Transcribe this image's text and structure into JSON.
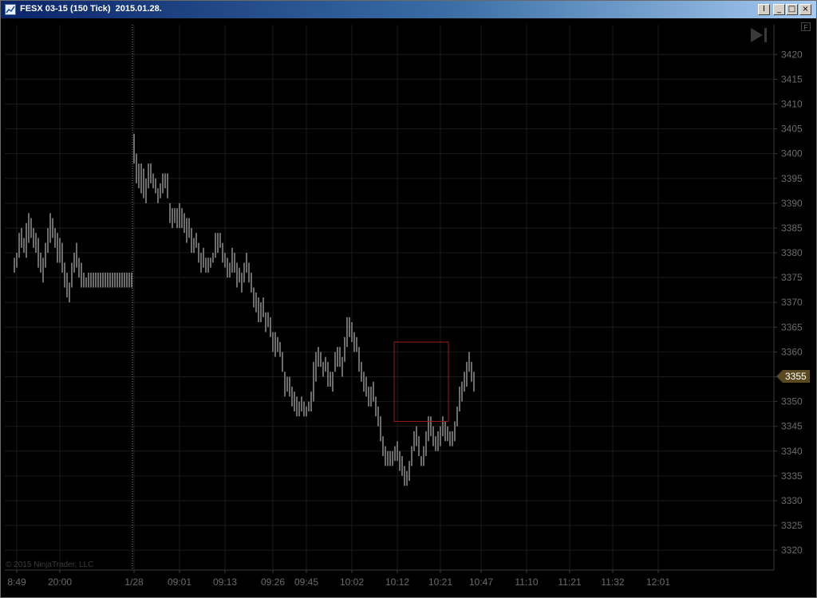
{
  "window": {
    "title": "FESX 03-15 (150 Tick)  2015.01.28.",
    "minimize_label": "_",
    "maximize_label": "□",
    "close_label": "×",
    "pin_label": "I"
  },
  "copyright": "© 2015 NinjaTrader, LLC",
  "f_label": "F",
  "last_price": "3355",
  "colors": {
    "background": "#000000",
    "bars": "#9a9a9a",
    "grid": "#1a1a1a",
    "axis_text": "#6b6b6b",
    "price_tag": "#5a4a22",
    "rectangle": "#9b1c1c",
    "session_line": "#8a8a8a"
  },
  "icons": {
    "app": "chart-icon",
    "play": "go-to-end-icon"
  },
  "chart_data": {
    "type": "bar",
    "title": "FESX 03-15 (150 Tick)",
    "subtitle": "2015.01.28.",
    "ylim": [
      3316,
      3426
    ],
    "yticks": [
      3320,
      3325,
      3330,
      3335,
      3340,
      3345,
      3350,
      3355,
      3360,
      3365,
      3370,
      3375,
      3380,
      3385,
      3390,
      3395,
      3400,
      3405,
      3410,
      3415,
      3420
    ],
    "xtick_labels": [
      "8:49",
      "20:00",
      "1/28",
      "09:01",
      "09:13",
      "09:26",
      "09:45",
      "10:02",
      "10:12",
      "10:21",
      "10:47",
      "11:10",
      "11:21",
      "11:32",
      "12:01"
    ],
    "xtick_bar_index": [
      1,
      19,
      50,
      69,
      88,
      108,
      122,
      141,
      160,
      178,
      195,
      214,
      232,
      250,
      269
    ],
    "session_break_index": 50,
    "grid": true,
    "last_price": 3355,
    "rectangle": {
      "start_index": 159,
      "end_index": 181,
      "high": 3362,
      "low": 3346
    },
    "bars": [
      [
        3379,
        3376
      ],
      [
        3380,
        3377
      ],
      [
        3384,
        3379
      ],
      [
        3385,
        3381
      ],
      [
        3383,
        3380
      ],
      [
        3386,
        3379
      ],
      [
        3388,
        3382
      ],
      [
        3387,
        3383
      ],
      [
        3385,
        3381
      ],
      [
        3384,
        3380
      ],
      [
        3383,
        3377
      ],
      [
        3380,
        3376
      ],
      [
        3379,
        3374
      ],
      [
        3382,
        3377
      ],
      [
        3385,
        3380
      ],
      [
        3388,
        3382
      ],
      [
        3387,
        3383
      ],
      [
        3385,
        3381
      ],
      [
        3384,
        3378
      ],
      [
        3383,
        3378
      ],
      [
        3382,
        3376
      ],
      [
        3378,
        3373
      ],
      [
        3376,
        3371
      ],
      [
        3374,
        3370
      ],
      [
        3378,
        3373
      ],
      [
        3380,
        3376
      ],
      [
        3382,
        3377
      ],
      [
        3379,
        3375
      ],
      [
        3378,
        3373
      ],
      [
        3376,
        3373
      ],
      [
        3375,
        3373
      ],
      [
        3376,
        3373
      ],
      [
        3376,
        3373
      ],
      [
        3376,
        3373
      ],
      [
        3376,
        3373
      ],
      [
        3376,
        3373
      ],
      [
        3376,
        3373
      ],
      [
        3376,
        3373
      ],
      [
        3376,
        3373
      ],
      [
        3376,
        3373
      ],
      [
        3376,
        3373
      ],
      [
        3376,
        3373
      ],
      [
        3376,
        3373
      ],
      [
        3376,
        3373
      ],
      [
        3376,
        3373
      ],
      [
        3376,
        3373
      ],
      [
        3376,
        3373
      ],
      [
        3376,
        3373
      ],
      [
        3376,
        3373
      ],
      [
        3376,
        3373
      ],
      [
        3404,
        3398
      ],
      [
        3400,
        3394
      ],
      [
        3398,
        3393
      ],
      [
        3398,
        3392
      ],
      [
        3397,
        3391
      ],
      [
        3395,
        3390
      ],
      [
        3398,
        3393
      ],
      [
        3398,
        3394
      ],
      [
        3396,
        3393
      ],
      [
        3395,
        3392
      ],
      [
        3393,
        3390
      ],
      [
        3394,
        3391
      ],
      [
        3396,
        3392
      ],
      [
        3396,
        3393
      ],
      [
        3396,
        3391
      ],
      [
        3390,
        3386
      ],
      [
        3389,
        3385
      ],
      [
        3389,
        3386
      ],
      [
        3389,
        3385
      ],
      [
        3390,
        3385
      ],
      [
        3389,
        3385
      ],
      [
        3388,
        3384
      ],
      [
        3387,
        3382
      ],
      [
        3387,
        3383
      ],
      [
        3385,
        3380
      ],
      [
        3383,
        3380
      ],
      [
        3384,
        3381
      ],
      [
        3382,
        3378
      ],
      [
        3380,
        3376
      ],
      [
        3381,
        3377
      ],
      [
        3379,
        3376
      ],
      [
        3379,
        3376
      ],
      [
        3379,
        3377
      ],
      [
        3380,
        3378
      ],
      [
        3384,
        3379
      ],
      [
        3384,
        3380
      ],
      [
        3384,
        3381
      ],
      [
        3382,
        3378
      ],
      [
        3380,
        3377
      ],
      [
        3379,
        3375
      ],
      [
        3378,
        3375
      ],
      [
        3381,
        3376
      ],
      [
        3380,
        3376
      ],
      [
        3378,
        3373
      ],
      [
        3377,
        3374
      ],
      [
        3376,
        3372
      ],
      [
        3378,
        3374
      ],
      [
        3380,
        3376
      ],
      [
        3378,
        3374
      ],
      [
        3376,
        3372
      ],
      [
        3373,
        3369
      ],
      [
        3372,
        3368
      ],
      [
        3371,
        3366
      ],
      [
        3370,
        3366
      ],
      [
        3371,
        3367
      ],
      [
        3368,
        3364
      ],
      [
        3368,
        3365
      ],
      [
        3367,
        3363
      ],
      [
        3364,
        3360
      ],
      [
        3364,
        3359
      ],
      [
        3363,
        3360
      ],
      [
        3362,
        3359
      ],
      [
        3360,
        3356
      ],
      [
        3356,
        3351
      ],
      [
        3355,
        3352
      ],
      [
        3355,
        3351
      ],
      [
        3353,
        3349
      ],
      [
        3352,
        3348
      ],
      [
        3351,
        3347
      ],
      [
        3350,
        3347
      ],
      [
        3351,
        3348
      ],
      [
        3350,
        3347
      ],
      [
        3349,
        3347
      ],
      [
        3350,
        3348
      ],
      [
        3352,
        3348
      ],
      [
        3358,
        3350
      ],
      [
        3360,
        3354
      ],
      [
        3361,
        3357
      ],
      [
        3360,
        3357
      ],
      [
        3358,
        3355
      ],
      [
        3359,
        3356
      ],
      [
        3358,
        3353
      ],
      [
        3356,
        3353
      ],
      [
        3356,
        3352
      ],
      [
        3360,
        3356
      ],
      [
        3361,
        3357
      ],
      [
        3361,
        3357
      ],
      [
        3359,
        3355
      ],
      [
        3363,
        3358
      ],
      [
        3367,
        3361
      ],
      [
        3367,
        3363
      ],
      [
        3366,
        3362
      ],
      [
        3364,
        3360
      ],
      [
        3363,
        3360
      ],
      [
        3361,
        3356
      ],
      [
        3358,
        3354
      ],
      [
        3356,
        3352
      ],
      [
        3355,
        3351
      ],
      [
        3353,
        3349
      ],
      [
        3353,
        3349
      ],
      [
        3354,
        3350
      ],
      [
        3351,
        3347
      ],
      [
        3349,
        3345
      ],
      [
        3347,
        3342
      ],
      [
        3343,
        3339
      ],
      [
        3341,
        3337
      ],
      [
        3340,
        3337
      ],
      [
        3340,
        3337
      ],
      [
        3340,
        3337
      ],
      [
        3341,
        3338
      ],
      [
        3342,
        3338
      ],
      [
        3340,
        3336
      ],
      [
        3339,
        3335
      ],
      [
        3337,
        3333
      ],
      [
        3336,
        3333
      ],
      [
        3338,
        3334
      ],
      [
        3341,
        3337
      ],
      [
        3344,
        3340
      ],
      [
        3345,
        3341
      ],
      [
        3343,
        3339
      ],
      [
        3339,
        3337
      ],
      [
        3341,
        3337
      ],
      [
        3344,
        3339
      ],
      [
        3347,
        3342
      ],
      [
        3347,
        3343
      ],
      [
        3345,
        3341
      ],
      [
        3343,
        3340
      ],
      [
        3344,
        3340
      ],
      [
        3345,
        3341
      ],
      [
        3347,
        3343
      ],
      [
        3346,
        3342
      ],
      [
        3345,
        3342
      ],
      [
        3344,
        3341
      ],
      [
        3344,
        3341
      ],
      [
        3346,
        3342
      ],
      [
        3349,
        3345
      ],
      [
        3353,
        3348
      ],
      [
        3354,
        3350
      ],
      [
        3356,
        3352
      ],
      [
        3358,
        3353
      ],
      [
        3360,
        3356
      ],
      [
        3358,
        3354
      ],
      [
        3356,
        3352
      ]
    ]
  }
}
